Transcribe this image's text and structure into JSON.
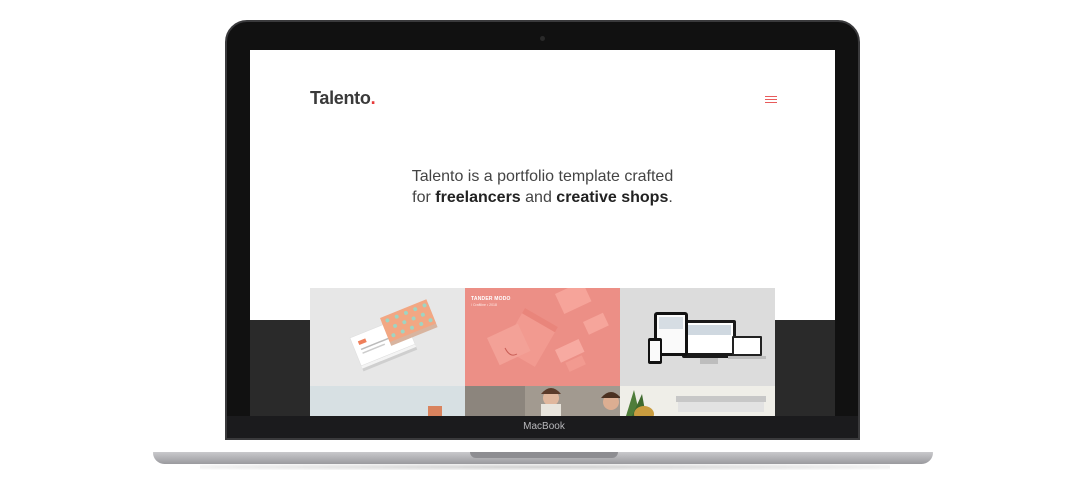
{
  "device": {
    "label": "MacBook"
  },
  "site": {
    "logo": {
      "text": "Talento",
      "dot": "."
    },
    "menu_icon": "hamburger-menu-icon",
    "tagline": {
      "line1": "Talento is a portfolio template crafted",
      "line2_prefix": "for",
      "line2_bold1": "freelancers",
      "line2_mid": "and",
      "line2_bold2": "creative shops",
      "line2_suffix": "."
    },
    "portfolio_tiles": [
      {
        "name": "business-cards"
      },
      {
        "name": "tander-modo-branding",
        "title": "TANDER MODO",
        "subtitle": "/ Craftline • 2018"
      },
      {
        "name": "responsive-devices"
      },
      {
        "name": "tile-4"
      },
      {
        "name": "tile-5"
      },
      {
        "name": "tile-6"
      }
    ],
    "colors": {
      "accent": "#e63a3a",
      "dark_band": "#2a2a2a",
      "coral": "#ec8f86"
    }
  }
}
